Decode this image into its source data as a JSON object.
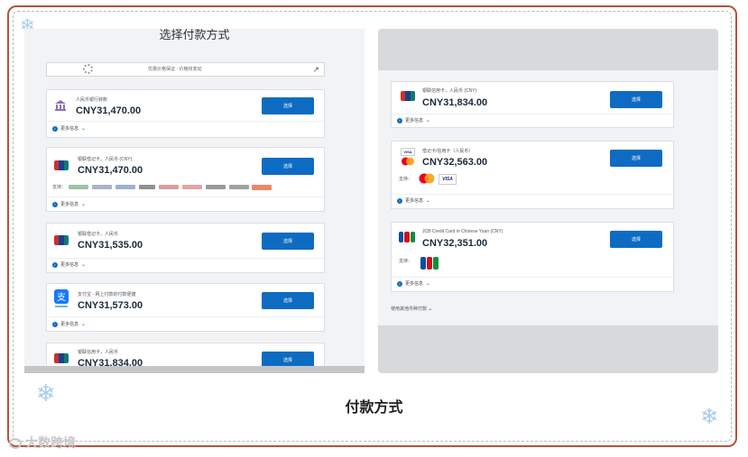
{
  "left_panel": {
    "title": "选择付款方式",
    "info_bar_text": "优惠价格保证 · 价格将变动",
    "cards": [
      {
        "description": "人民币银行转账",
        "price": "CNY31,470.00",
        "button": "选择",
        "more_info": "更多信息"
      },
      {
        "description": "银联借记卡，人民币 (CNY)",
        "price": "CNY31,470.00",
        "button": "选择",
        "support_label": "支持：",
        "more_info": "更多信息"
      },
      {
        "description": "银联借记卡，人民币",
        "price": "CNY31,535.00",
        "button": "选择",
        "more_info": "更多信息"
      },
      {
        "description": "支付宝 - 网上付款的付款便捷",
        "price": "CNY31,573.00",
        "button": "选择",
        "more_info": "更多信息"
      },
      {
        "description": "银联信用卡，人民币",
        "price": "CNY31,834.00",
        "button": "选择"
      }
    ]
  },
  "right_panel": {
    "cards": [
      {
        "description": "银联信用卡，人民币 (CNY)",
        "price": "CNY31,834.00",
        "button": "选择",
        "more_info": "更多信息"
      },
      {
        "description": "借记卡/信用卡（人民币）",
        "price": "CNY32,563.00",
        "button": "选择",
        "support_label": "支持：",
        "more_info": "更多信息"
      },
      {
        "description": "JCB Credit Card in Chinese Yuan (CNY)",
        "price": "CNY32,351.00",
        "button": "选择",
        "support_label": "支持：",
        "more_info": "更多信息"
      }
    ],
    "other_currency": "使用其他币种付款"
  },
  "caption": "付款方式",
  "watermark": "大数跨境",
  "colors": {
    "frame_border": "#b5533c",
    "button_blue": "#0d6cc2",
    "panel_bg": "#f2f3f5",
    "right_panel_bg": "#d8d9db"
  },
  "icons": [
    "bank-icon",
    "unionpay-icon",
    "alipay-icon",
    "mastercard-icon",
    "visa-icon",
    "jcb-icon",
    "snowflake-icon",
    "info-icon",
    "chevron-down-icon",
    "external-link-icon"
  ]
}
